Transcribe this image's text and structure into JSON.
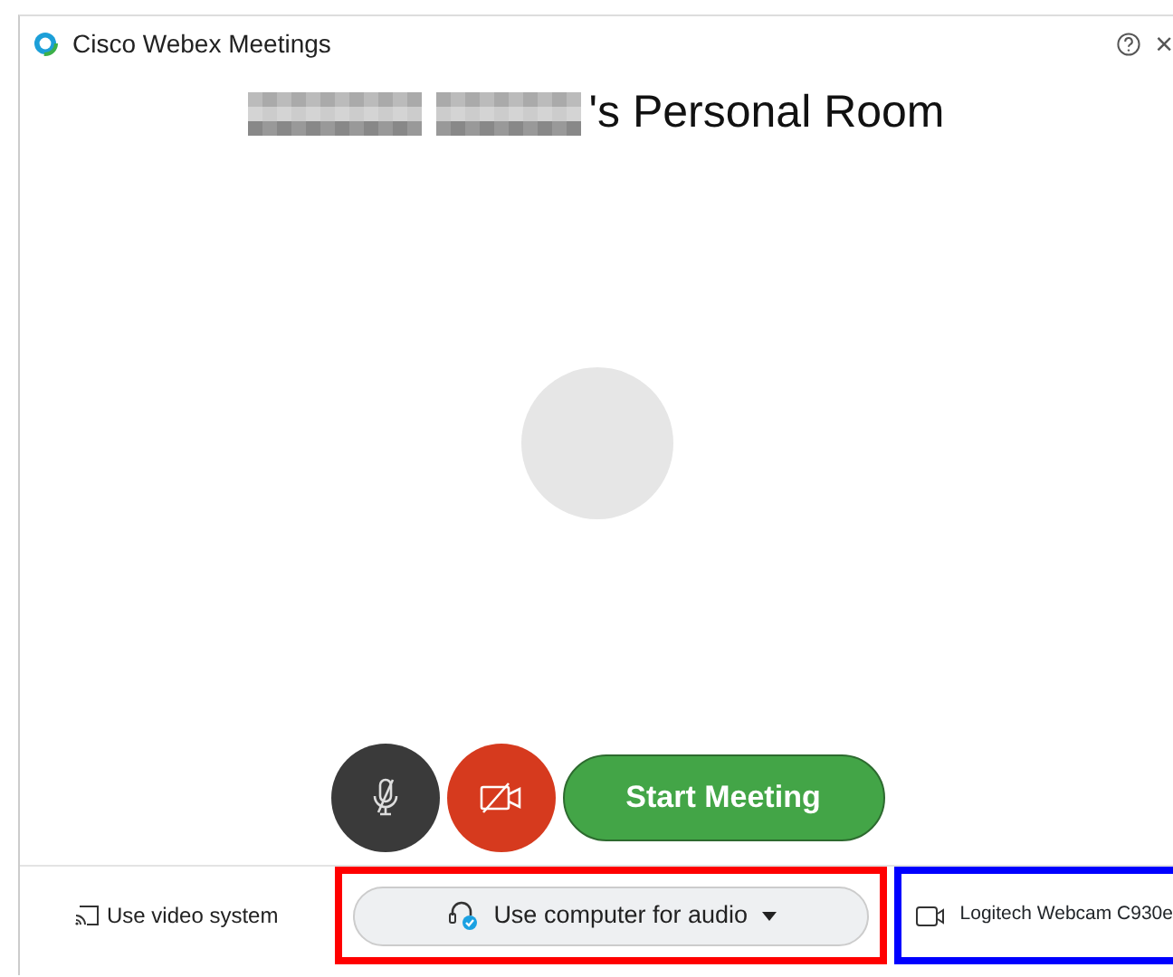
{
  "window": {
    "title": "Cisco Webex Meetings",
    "close": "×"
  },
  "heading": {
    "suffix": "'s Personal Room"
  },
  "controls": {
    "mic_muted": true,
    "video_off": true,
    "start_label": "Start Meeting"
  },
  "bottom_bar": {
    "video_system": "Use video system",
    "audio": "Use computer for audio",
    "camera": "Logitech Webcam C930e"
  }
}
